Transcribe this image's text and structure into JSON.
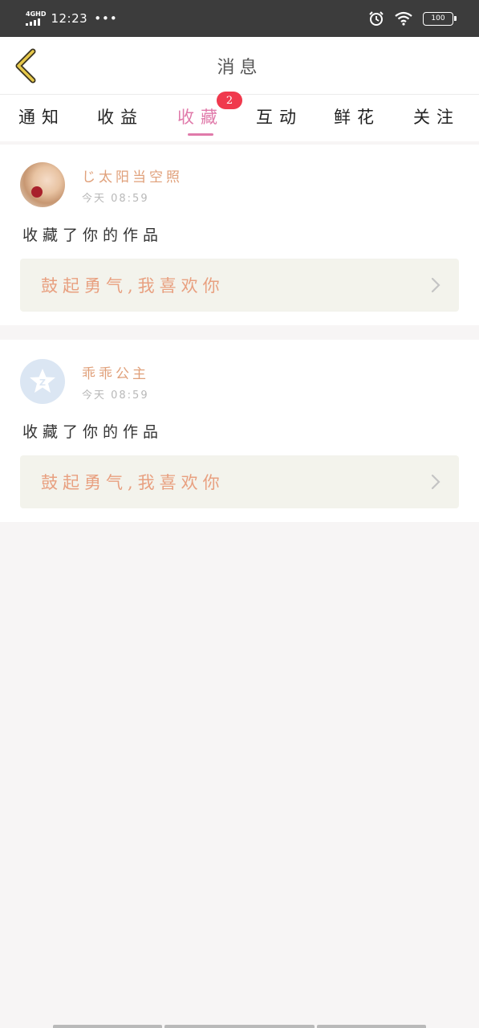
{
  "status_bar": {
    "network": "4GHD",
    "time": "12:23",
    "dots": "•••",
    "battery": "100"
  },
  "header": {
    "title": "消息",
    "back_icon": "chevron-left-icon"
  },
  "tabs": [
    {
      "label": "通知",
      "active": false
    },
    {
      "label": "收益",
      "active": false
    },
    {
      "label": "收藏",
      "active": true,
      "badge": "2"
    },
    {
      "label": "互动",
      "active": false
    },
    {
      "label": "鲜花",
      "active": false
    },
    {
      "label": "关注",
      "active": false
    }
  ],
  "messages": [
    {
      "username": "じ太阳当空照",
      "time": "今天 08:59",
      "action": "收藏了你的作品",
      "work_title": "鼓起勇气,我喜欢你",
      "avatar": "photo-avatar"
    },
    {
      "username": "乖乖公主",
      "time": "今天 08:59",
      "action": "收藏了你的作品",
      "work_title": "鼓起勇气,我喜欢你",
      "avatar": "default-avatar"
    }
  ],
  "colors": {
    "accent": "#e07aaa",
    "badge": "#f0394d",
    "username": "#e0a07a",
    "work_title": "#e8a080",
    "work_box": "#f3f3ec",
    "back_icon": "#e6c84a"
  }
}
